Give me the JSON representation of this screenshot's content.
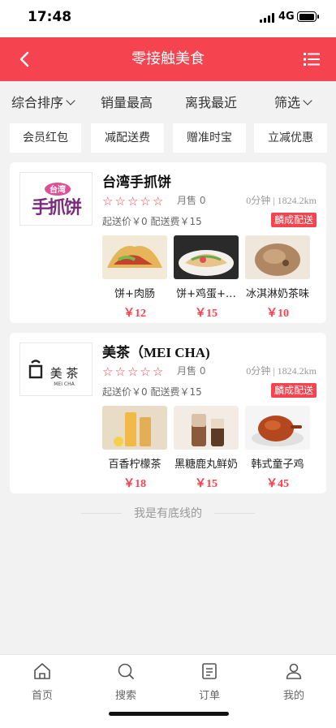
{
  "status": {
    "time": "17:48",
    "network": "4G"
  },
  "nav": {
    "title": "零接触美食"
  },
  "sort": [
    "综合排序",
    "销量最高",
    "离我最近",
    "筛选"
  ],
  "filters": [
    "会员红包",
    "减配送费",
    "赠准时宝",
    "立减优惠"
  ],
  "stores": [
    {
      "name": "台湾手抓饼",
      "logo_text": "台湾手抓饼",
      "monthly_sales": "月售 0",
      "distance": "0分钟 | 1824.2km",
      "min_fee": "起送价￥0  配送费￥15",
      "badge": "麟成配送",
      "products": [
        {
          "name": "饼+肉肠",
          "price": "￥12"
        },
        {
          "name": "饼+鸡蛋+…",
          "price": "￥15"
        },
        {
          "name": "冰淇淋奶茶味",
          "price": "￥10"
        }
      ]
    },
    {
      "name": "美茶（MEI CHA)",
      "logo_text": "美茶",
      "logo_sub": "MEI CHA",
      "monthly_sales": "月售 0",
      "distance": "0分钟 | 1824.2km",
      "min_fee": "起送价￥0  配送费￥15",
      "badge": "麟成配送",
      "products": [
        {
          "name": "百香柠檬茶",
          "price": "￥18"
        },
        {
          "name": "黑糖鹿丸鲜奶",
          "price": "￥15"
        },
        {
          "name": "韩式童子鸡",
          "price": "￥45"
        }
      ]
    }
  ],
  "bottom_text": "我是有底线的",
  "tabs": [
    {
      "label": "首页",
      "icon": "home-icon"
    },
    {
      "label": "搜索",
      "icon": "search-icon"
    },
    {
      "label": "订单",
      "icon": "order-icon"
    },
    {
      "label": "我的",
      "icon": "user-icon"
    }
  ],
  "colors": {
    "accent": "#f5434f",
    "background": "#f2f2f2"
  }
}
